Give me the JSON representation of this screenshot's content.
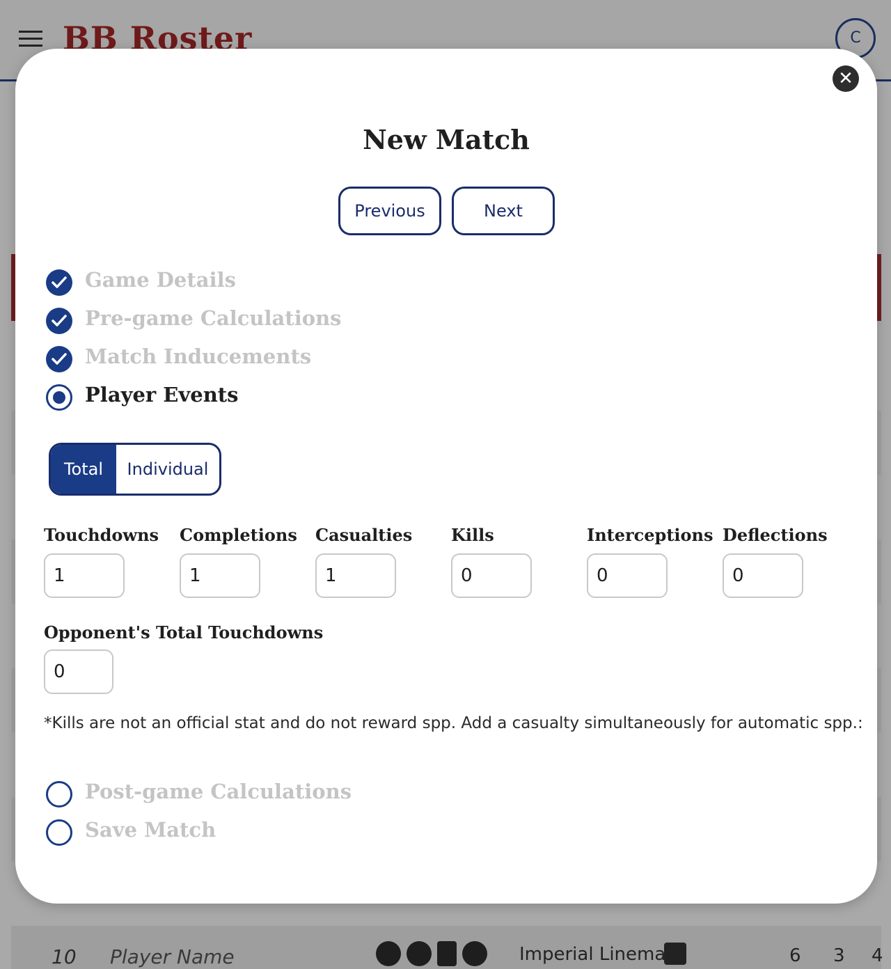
{
  "app": {
    "title": "BB Roster",
    "avatar_initial": "C"
  },
  "background_row": {
    "number": "10",
    "player_name": "Player Name",
    "position": "Imperial Lineman",
    "stats": [
      "6",
      "3",
      "4"
    ]
  },
  "modal": {
    "title": "New Match",
    "close_symbol": "✕",
    "previous_label": "Previous",
    "next_label": "Next",
    "steps": [
      {
        "label": "Game Details",
        "state": "done"
      },
      {
        "label": "Pre-game Calculations",
        "state": "done"
      },
      {
        "label": "Match Inducements",
        "state": "done"
      },
      {
        "label": "Player Events",
        "state": "active"
      },
      {
        "label": "Post-game Calculations",
        "state": "todo"
      },
      {
        "label": "Save Match",
        "state": "todo"
      }
    ],
    "toggle": {
      "total_label": "Total",
      "individual_label": "Individual",
      "selected": "Total"
    },
    "stats": [
      {
        "label": "Touchdowns",
        "value": "1"
      },
      {
        "label": "Completions",
        "value": "1"
      },
      {
        "label": "Casualties",
        "value": "1"
      },
      {
        "label": "Kills",
        "value": "0"
      },
      {
        "label": "Interceptions",
        "value": "0"
      },
      {
        "label": "Deflections",
        "value": "0"
      }
    ],
    "opponent_touchdowns": {
      "label": "Opponent's Total Touchdowns",
      "value": "0"
    },
    "note": "*Kills are not an official stat and do not reward spp. Add a casualty simultaneously for automatic spp.:"
  },
  "colors": {
    "primary": "#1a3c86",
    "outline": "#1a2c6b",
    "brand": "#6f1a1a",
    "muted_step": "#c4c4c4"
  }
}
